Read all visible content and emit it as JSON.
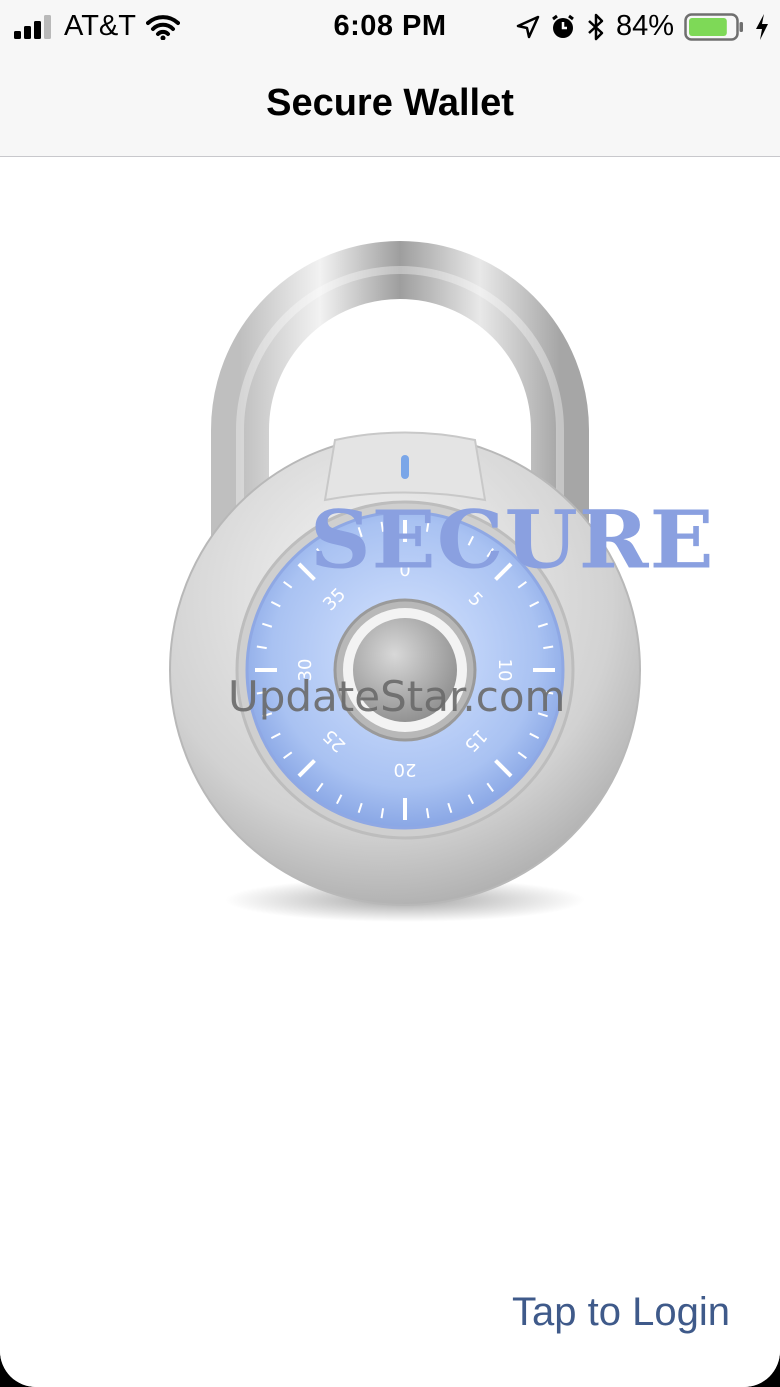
{
  "status_bar": {
    "carrier": "AT&T",
    "time": "6:08 PM",
    "battery_percent": "84%",
    "battery_level": 0.84,
    "icons": [
      "signal-icon",
      "wifi-icon",
      "location-icon",
      "alarm-icon",
      "bluetooth-icon",
      "battery-icon",
      "charging-icon"
    ]
  },
  "nav": {
    "title": "Secure Wallet"
  },
  "main": {
    "secure_label": "SECURE",
    "watermark": "UpdateStar.com",
    "dial_numbers": [
      "0",
      "5",
      "10",
      "15",
      "20",
      "25",
      "30",
      "35"
    ],
    "login_label": "Tap to Login"
  },
  "colors": {
    "accent": "#3f5a8a",
    "secure": "#8aa0e0",
    "dial": "#a9c2f2",
    "battery": "#7ed957"
  }
}
